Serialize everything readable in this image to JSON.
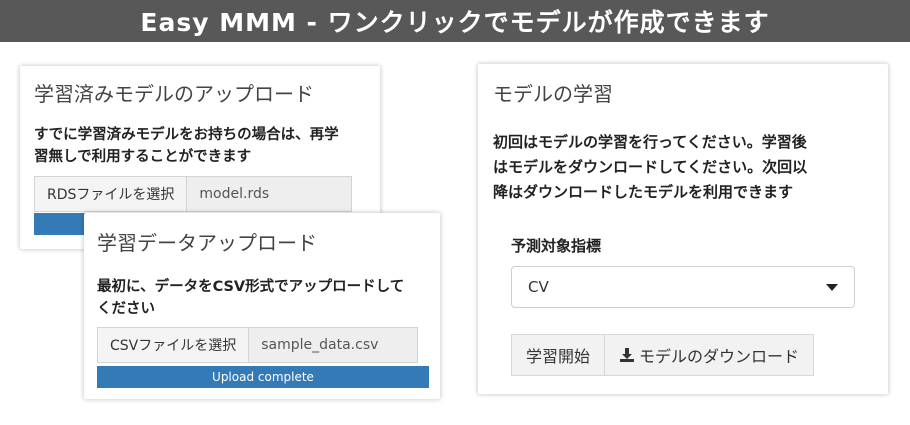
{
  "banner": {
    "title": "Easy MMM  -  ワンクリックでモデルが作成できます"
  },
  "pretrained_panel": {
    "title": "学習済みモデルのアップロード",
    "desc_line1": "すでに学習済みモデルをお持ちの場合は、再学",
    "desc_line2": "習無しで利用することができます",
    "file_button": "RDSファイルを選択",
    "file_name": "model.rds"
  },
  "data_panel": {
    "title": "学習データアップロード",
    "desc_line1": "最初に、データをCSV形式でアップロードして",
    "desc_line2": "ください",
    "file_button": "CSVファイルを選択",
    "file_name": "sample_data.csv",
    "progress_label": "Upload complete",
    "progress_value": 1.0
  },
  "train_panel": {
    "title": "モデルの学習",
    "desc_line1": "初回はモデルの学習を行ってください。学習後",
    "desc_line2": "はモデルをダウンロードしてください。次回以",
    "desc_line3": "降はダウンロードしたモデルを利用できます",
    "target_label": "予測対象指標",
    "target_value": "CV",
    "train_button": "学習開始",
    "download_button": "モデルのダウンロード",
    "download_icon": "download-icon"
  },
  "colors": {
    "banner_bg": "#585858",
    "progress_bar": "#337ab7"
  }
}
